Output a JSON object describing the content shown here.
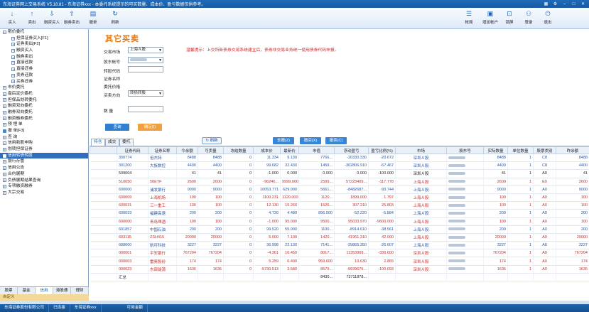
{
  "titlebar": {
    "title": "东海证券网上交易系统 V5.18.81 - 东海证券xxx - 本委托系统提示的可买数量、成本价、盈亏数据仅供参考。"
  },
  "toolbar": {
    "items": [
      {
        "label": "买入",
        "icon": "buy-icon",
        "glyph": "↓"
      },
      {
        "label": "卖出",
        "icon": "sell-icon",
        "glyph": "↑"
      },
      {
        "label": "融资买入",
        "icon": "margin-buy-icon",
        "glyph": "⇩"
      },
      {
        "label": "融券卖出",
        "icon": "short-sell-icon",
        "glyph": "⇧"
      },
      {
        "label": "撤单",
        "icon": "cancel-order-icon",
        "glyph": "▤"
      },
      {
        "label": "刷新",
        "icon": "refresh-icon",
        "glyph": "↻"
      },
      {
        "label": "帐简",
        "icon": "account-brief-icon",
        "glyph": "☰"
      },
      {
        "label": "增加帐户",
        "icon": "add-account-icon",
        "glyph": "▣"
      },
      {
        "label": "锁屏",
        "icon": "lock-icon",
        "glyph": "⊡"
      },
      {
        "label": "登录",
        "icon": "login-icon",
        "glyph": "⚇"
      },
      {
        "label": "退出",
        "icon": "exit-icon",
        "glyph": "⏻"
      }
    ]
  },
  "sidebar": {
    "items": [
      {
        "label": "限价委托",
        "type": "minus"
      },
      {
        "label": "担保证券买入[F1]",
        "type": "leaf"
      },
      {
        "label": "证券卖出[F2]",
        "type": "leaf"
      },
      {
        "label": "融资买入",
        "type": "leaf"
      },
      {
        "label": "融券卖出",
        "type": "leaf"
      },
      {
        "label": "直接还款",
        "type": "leaf"
      },
      {
        "label": "直接还券",
        "type": "leaf"
      },
      {
        "label": "卖券还款",
        "type": "leaf"
      },
      {
        "label": "买券还券",
        "type": "leaf"
      },
      {
        "label": "市价委托",
        "type": "plus"
      },
      {
        "label": "盘后定价委托",
        "type": "plus"
      },
      {
        "label": "担保品划转委托",
        "type": "plus"
      },
      {
        "label": "融资双向委托",
        "type": "plus"
      },
      {
        "label": "融券双向委托",
        "type": "plus"
      },
      {
        "label": "融资融券委托",
        "type": "plus"
      },
      {
        "label": "预 埋 单",
        "type": "plus"
      },
      {
        "label": "撤    单[F3]",
        "type": "icon"
      },
      {
        "label": "查    询",
        "type": "plus"
      },
      {
        "label": "信用新股申购",
        "type": "plus"
      },
      {
        "label": "划转担保证券",
        "type": "plus"
      },
      {
        "label": "信用转债转股",
        "type": "selected"
      },
      {
        "label": "银行存管",
        "type": "plus"
      },
      {
        "label": "信用公告",
        "type": "plus"
      },
      {
        "label": "合约展期",
        "type": "plus"
      },
      {
        "label": "负债展期结果查询",
        "type": "plus"
      },
      {
        "label": "专项融资融券",
        "type": "plus"
      },
      {
        "label": "大宗交易",
        "type": "plus"
      }
    ]
  },
  "sidetabs": [
    {
      "label": "股票"
    },
    {
      "label": "基金"
    },
    {
      "label": "信用"
    },
    {
      "label": "港股通"
    },
    {
      "label": "理财"
    }
  ],
  "sideinfo": "自定义",
  "form": {
    "title": "其它买卖",
    "market_label": "交易市场",
    "market_value": "上海Ａ股",
    "account_label": "股东帐号",
    "code_label": "转股代码",
    "name_label": "证券名称",
    "price_label": "委托价格",
    "direction_label": "买卖方向",
    "direction_value": "转债转股",
    "qty_label": "数    量",
    "tip": "温馨提示：上交所新债券交易系统建立后，债券非交易业务统一使用债券代码申报。",
    "query_label": "查询",
    "confirm_label": "确定(I)"
  },
  "midbar": {
    "tabs": [
      {
        "label": "持仓"
      },
      {
        "label": "成交"
      },
      {
        "label": "委托"
      }
    ],
    "refresh_label": "刷新",
    "btn_all": "全撤(Z)",
    "btn_buy": "撤买(X)",
    "btn_sell": "撤卖(C)"
  },
  "table": {
    "headers": [
      "证券代码",
      "证券名称",
      "今余额",
      "可卖量",
      "冻结数量",
      "成本价",
      "最新价",
      "市值",
      "浮动盈亏",
      "盈亏比例(%)",
      "市场",
      "股东号",
      "实际数量",
      "单位数量",
      "股票类别",
      "昨余额"
    ],
    "rows": [
      {
        "color": "blue",
        "cells": [
          "300774",
          "倍杰特",
          "8488",
          "8488",
          "0",
          "11.334",
          "9.130",
          "7766...",
          "-20330.330",
          "-20.672",
          "深圳Ａ股",
          "",
          "8488",
          "1",
          "C8",
          "8488"
        ]
      },
      {
        "color": "blue",
        "cells": [
          "301200",
          "大族数控",
          "4400",
          "4400",
          "0",
          "99.682",
          "32.430",
          "1459...",
          "-302806.910",
          "-67.467",
          "深圳Ａ股",
          "",
          "4400",
          "1",
          "C8",
          "4400"
        ]
      },
      {
        "color": "dark",
        "cells": [
          "509004",
          "",
          "41",
          "41",
          "0",
          "-1.000",
          "0.000",
          "0.000",
          "0.000",
          "-100.000",
          "深圳Ａ股",
          "",
          "41",
          "1",
          "A0",
          "41"
        ]
      },
      {
        "color": "red",
        "cells": [
          "510050",
          "50ETF",
          "2600",
          "2600",
          "0",
          "-96246...",
          "9999.000",
          "2599...",
          "57223409...",
          "-117.778",
          "上海Ａ股",
          "",
          "2600",
          "1",
          "E0",
          "2600"
        ]
      },
      {
        "color": "blue",
        "cells": [
          "600000",
          "浦发银行",
          "9000",
          "9000",
          "0",
          "10053.771",
          "629.000",
          "5661...",
          "-8482687...",
          "-93.744",
          "上海Ａ股",
          "",
          "9000",
          "1",
          "A0",
          "9000"
        ]
      },
      {
        "color": "red",
        "cells": [
          "600009",
          "上海机场",
          "100",
          "100",
          "0",
          "1100.231",
          "1120.000",
          "1120...",
          "1899.000",
          "1.797",
          "上海Ａ股",
          "",
          "100",
          "1",
          "A0",
          "100"
        ]
      },
      {
        "color": "red",
        "cells": [
          "600031",
          "三一重工",
          "100",
          "100",
          "0",
          "12.130",
          "15.260",
          "1526...",
          "307.210",
          "25.803",
          "上海Ａ股",
          "",
          "100",
          "1",
          "A0",
          "100"
        ]
      },
      {
        "color": "blue",
        "cells": [
          "600033",
          "福建高速",
          "200",
          "200",
          "0",
          "4.730",
          "4.480",
          "896.000",
          "-52.220",
          "-5.884",
          "上海Ａ股",
          "",
          "200",
          "1",
          "A0",
          "200"
        ]
      },
      {
        "color": "red",
        "cells": [
          "600600",
          "青岛啤酒",
          "100",
          "100",
          "0",
          "-1.000",
          "95.000",
          "9500...",
          "95033.970",
          "-9600.000",
          "上海Ａ股",
          "",
          "100",
          "1",
          "A0",
          "100"
        ]
      },
      {
        "color": "blue",
        "cells": [
          "601857",
          "中国石油",
          "200",
          "200",
          "0",
          "99.520",
          "55.000",
          "1100...",
          "-8914.610",
          "-38.561",
          "上海Ａ股",
          "",
          "200",
          "1",
          "A0",
          "200"
        ]
      },
      {
        "color": "red",
        "cells": [
          "603115",
          "ZSH415",
          "20000",
          "20000",
          "0",
          "5.000",
          "7.100",
          "1420...",
          "41961.310",
          "42.000",
          "上海Ａ股",
          "",
          "20000",
          "1",
          "A0",
          "20000"
        ]
      },
      {
        "color": "blue",
        "cells": [
          "688000",
          "航可科技",
          "3227",
          "3227",
          "0",
          "36.998",
          "22.130",
          "7141...",
          "-29865.350",
          "-26.607",
          "上海Ａ股",
          "",
          "3227",
          "1",
          "A8",
          "3227"
        ]
      },
      {
        "color": "red",
        "cells": [
          "000001",
          "平安银行",
          "767204",
          "767204",
          "0",
          "-4.361",
          "10.450",
          "8017...",
          "11353909...",
          "-339.600",
          "深圳Ａ股",
          "",
          "767204",
          "1",
          "A0",
          "767204"
        ]
      },
      {
        "color": "red",
        "cells": [
          "000003",
          "雷奥股份",
          "174",
          "174",
          "0",
          "5.259",
          "6.400",
          "959.600",
          "19.630",
          "2.865",
          "深圳Ａ股",
          "",
          "174",
          "1",
          "A0",
          "174"
        ]
      },
      {
        "color": "red",
        "cells": [
          "000023",
          "东部能源",
          "1636",
          "1636",
          "0",
          "-5730.513",
          "3.580",
          "8579...",
          "-9939675...",
          "-100.093",
          "深圳Ａ股",
          "",
          "1636",
          "1",
          "A0",
          "1636"
        ]
      }
    ],
    "sum_label": "汇总",
    "sum_market": "8430...",
    "sum_pl": "73711878..."
  },
  "statusbar": [
    "东海证券股份有限公司",
    "已连接",
    "东海证券xxx",
    "可用金额"
  ]
}
